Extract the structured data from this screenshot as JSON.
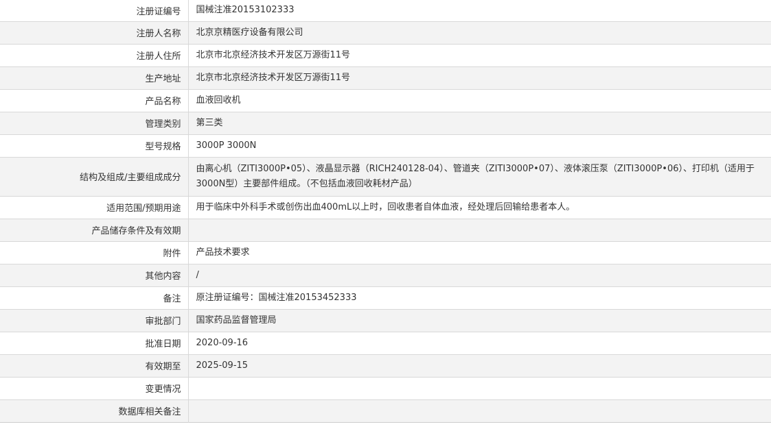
{
  "records": [
    {
      "label": "注册证编号",
      "value": "国械注准20153102333"
    },
    {
      "label": "注册人名称",
      "value": "北京京精医疗设备有限公司"
    },
    {
      "label": "注册人住所",
      "value": "北京市北京经济技术开发区万源街11号"
    },
    {
      "label": "生产地址",
      "value": "北京市北京经济技术开发区万源街11号"
    },
    {
      "label": "产品名称",
      "value": "血液回收机"
    },
    {
      "label": "管理类别",
      "value": "第三类"
    },
    {
      "label": "型号规格",
      "value": "3000P 3000N"
    },
    {
      "label": "结构及组成/主要组成成分",
      "value": "由离心机（ZITI3000P•05）、液晶显示器（RICH240128-04）、管道夹（ZITI3000P•07）、液体滚压泵（ZITI3000P•06）、打印机（适用于3000N型）主要部件组成。（不包括血液回收耗材产品）"
    },
    {
      "label": "适用范围/预期用途",
      "value": "用于临床中外科手术或创伤出血400mL以上时，回收患者自体血液，经处理后回输给患者本人。"
    },
    {
      "label": "产品储存条件及有效期",
      "value": ""
    },
    {
      "label": "附件",
      "value": "产品技术要求"
    },
    {
      "label": "其他内容",
      "value": "/"
    },
    {
      "label": "备注",
      "value": "原注册证编号：国械注准20153452333"
    },
    {
      "label": "审批部门",
      "value": "国家药品监督管理局"
    },
    {
      "label": "批准日期",
      "value": "2020-09-16"
    },
    {
      "label": "有效期至",
      "value": "2025-09-15"
    },
    {
      "label": "变更情况",
      "value": ""
    },
    {
      "label": "数据库相关备注",
      "value": ""
    }
  ]
}
